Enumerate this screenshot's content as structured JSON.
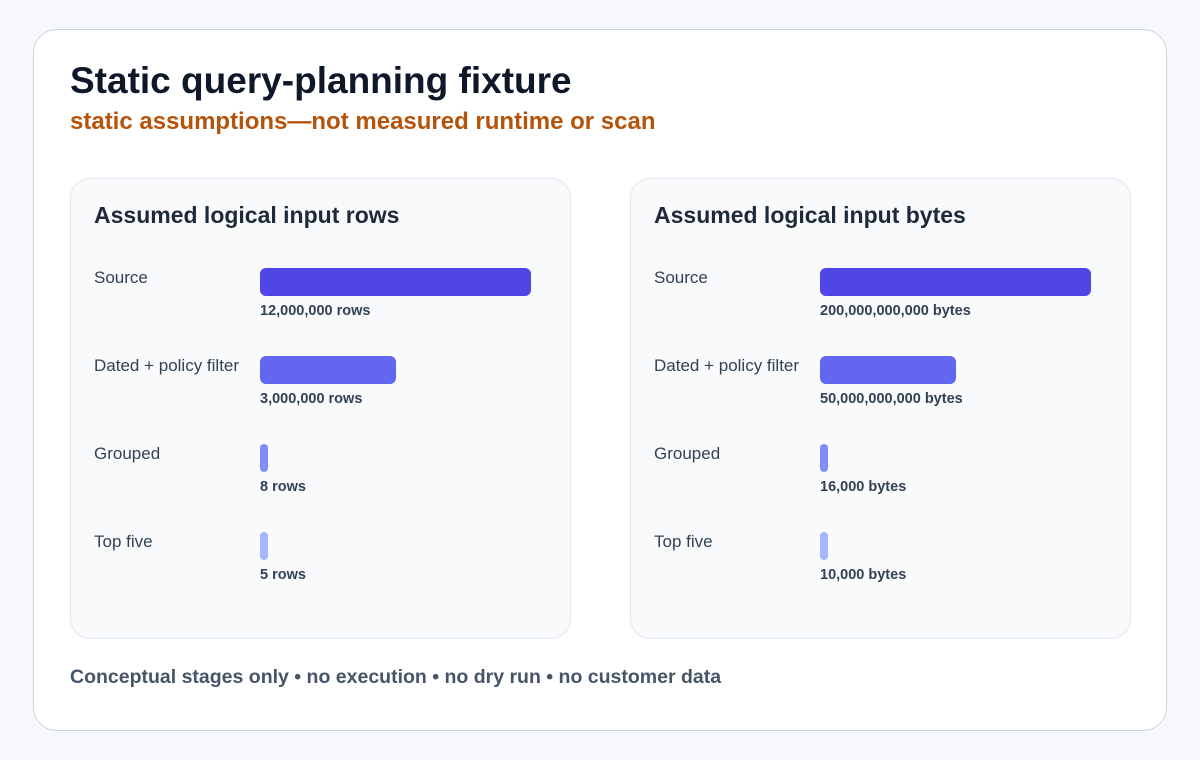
{
  "header": {
    "title": "Static query-planning fixture",
    "subtitle": "static assumptions—not measured runtime or scan"
  },
  "chart_data": [
    {
      "type": "bar",
      "orientation": "horizontal",
      "title": "Assumed logical input rows",
      "categories": [
        "Source",
        "Dated + policy filter",
        "Grouped",
        "Top five"
      ],
      "values": [
        12000000,
        3000000,
        8,
        5
      ],
      "value_labels": [
        "12,000,000 rows",
        "3,000,000 rows",
        "8 rows",
        "5 rows"
      ],
      "colors": [
        "#4f46e5",
        "#6366f1",
        "#818cf8",
        "#a5b4fc"
      ]
    },
    {
      "type": "bar",
      "orientation": "horizontal",
      "title": "Assumed logical input bytes",
      "categories": [
        "Source",
        "Dated + policy filter",
        "Grouped",
        "Top five"
      ],
      "values": [
        200000000000,
        50000000000,
        16000,
        10000
      ],
      "value_labels": [
        "200,000,000,000 bytes",
        "50,000,000,000 bytes",
        "16,000 bytes",
        "10,000 bytes"
      ],
      "colors": [
        "#4f46e5",
        "#6366f1",
        "#818cf8",
        "#a5b4fc"
      ]
    }
  ],
  "footer": {
    "note": "Conceptual stages only • no execution • no dry run • no customer data"
  }
}
